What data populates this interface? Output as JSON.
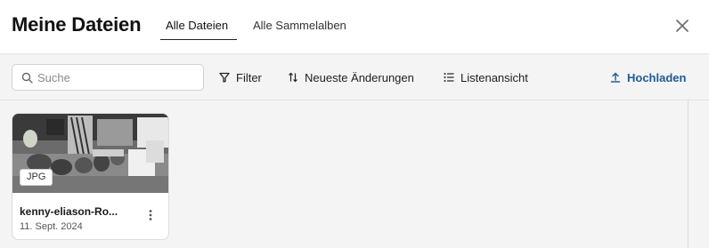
{
  "header": {
    "title": "Meine Dateien",
    "tabs": [
      {
        "label": "Alle Dateien",
        "active": true
      },
      {
        "label": "Alle Sammelalben",
        "active": false
      }
    ],
    "close_icon": "close-icon"
  },
  "toolbar": {
    "search": {
      "placeholder": "Suche",
      "value": ""
    },
    "filter_label": "Filter",
    "sort_label": "Neueste Änderungen",
    "view_label": "Listenansicht",
    "upload_label": "Hochladen",
    "accent_color": "#1e5a96"
  },
  "files": [
    {
      "type_badge": "JPG",
      "name": "kenny-eliason-Ro...",
      "date": "11. Sept. 2024"
    }
  ]
}
